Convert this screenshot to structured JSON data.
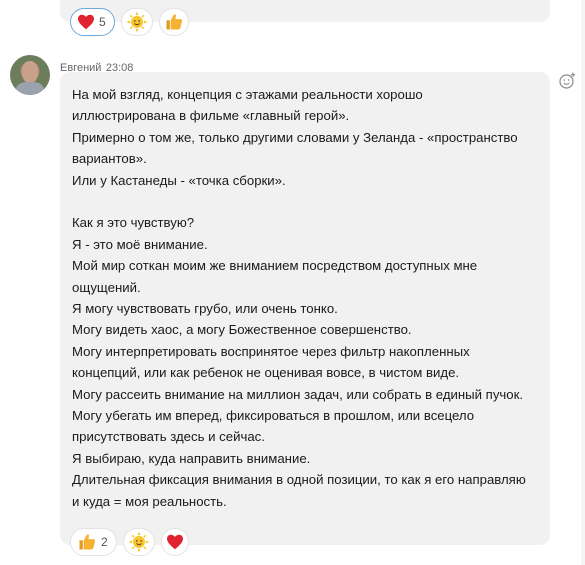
{
  "previous_message": {
    "reactions": [
      {
        "emoji": "heart-icon",
        "count": "5",
        "selected": true
      },
      {
        "emoji": "sun-smile-icon",
        "count": "",
        "selected": false
      },
      {
        "emoji": "thumbs-up-icon",
        "count": "",
        "selected": false
      }
    ]
  },
  "message": {
    "sender": "Евгений",
    "time": "23:08",
    "lines": [
      "На мой взгляд, концепция с этажами реальности хорошо",
      "иллюстрирована в фильме «главный герой».",
      "Примерно о том же, только другими словами у Зеланда - «пространство",
      "вариантов».",
      "Или у Кастанеды - «точка сборки».",
      "",
      "Как я это чувствую?",
      "Я - это моё внимание.",
      "Мой мир соткан моим же вниманием посредством доступных мне",
      "ощущений.",
      "Я могу чувствовать грубо, или очень тонко.",
      "Могу видеть хаос, а могу Божественное совершенство.",
      "Могу интерпретировать воспринятое через фильтр накопленных",
      "концепций, или как ребенок не оценивая вовсе, в чистом виде.",
      "Могу рассеить внимание на миллион задач, или собрать в единый пучок.",
      "Могу убегать им вперед, фиксироваться в прошлом, или всецело",
      "присутствовать здесь и сейчас.",
      "Я выбираю, куда направить внимание.",
      "Длительная фиксация внимания в одной позиции, то как я его направляю",
      "и куда = моя реальность."
    ],
    "reactions": [
      {
        "emoji": "thumbs-up-icon",
        "count": "2",
        "selected": false
      },
      {
        "emoji": "sun-smile-icon",
        "count": "",
        "selected": false
      },
      {
        "emoji": "heart-icon",
        "count": "",
        "selected": false
      }
    ]
  },
  "colors": {
    "bubble": "#f1f1f1",
    "heart": "#e0242f",
    "sun": "#f7c62f",
    "thumb": "#f5b233",
    "selected_border": "#6fa8dc"
  }
}
